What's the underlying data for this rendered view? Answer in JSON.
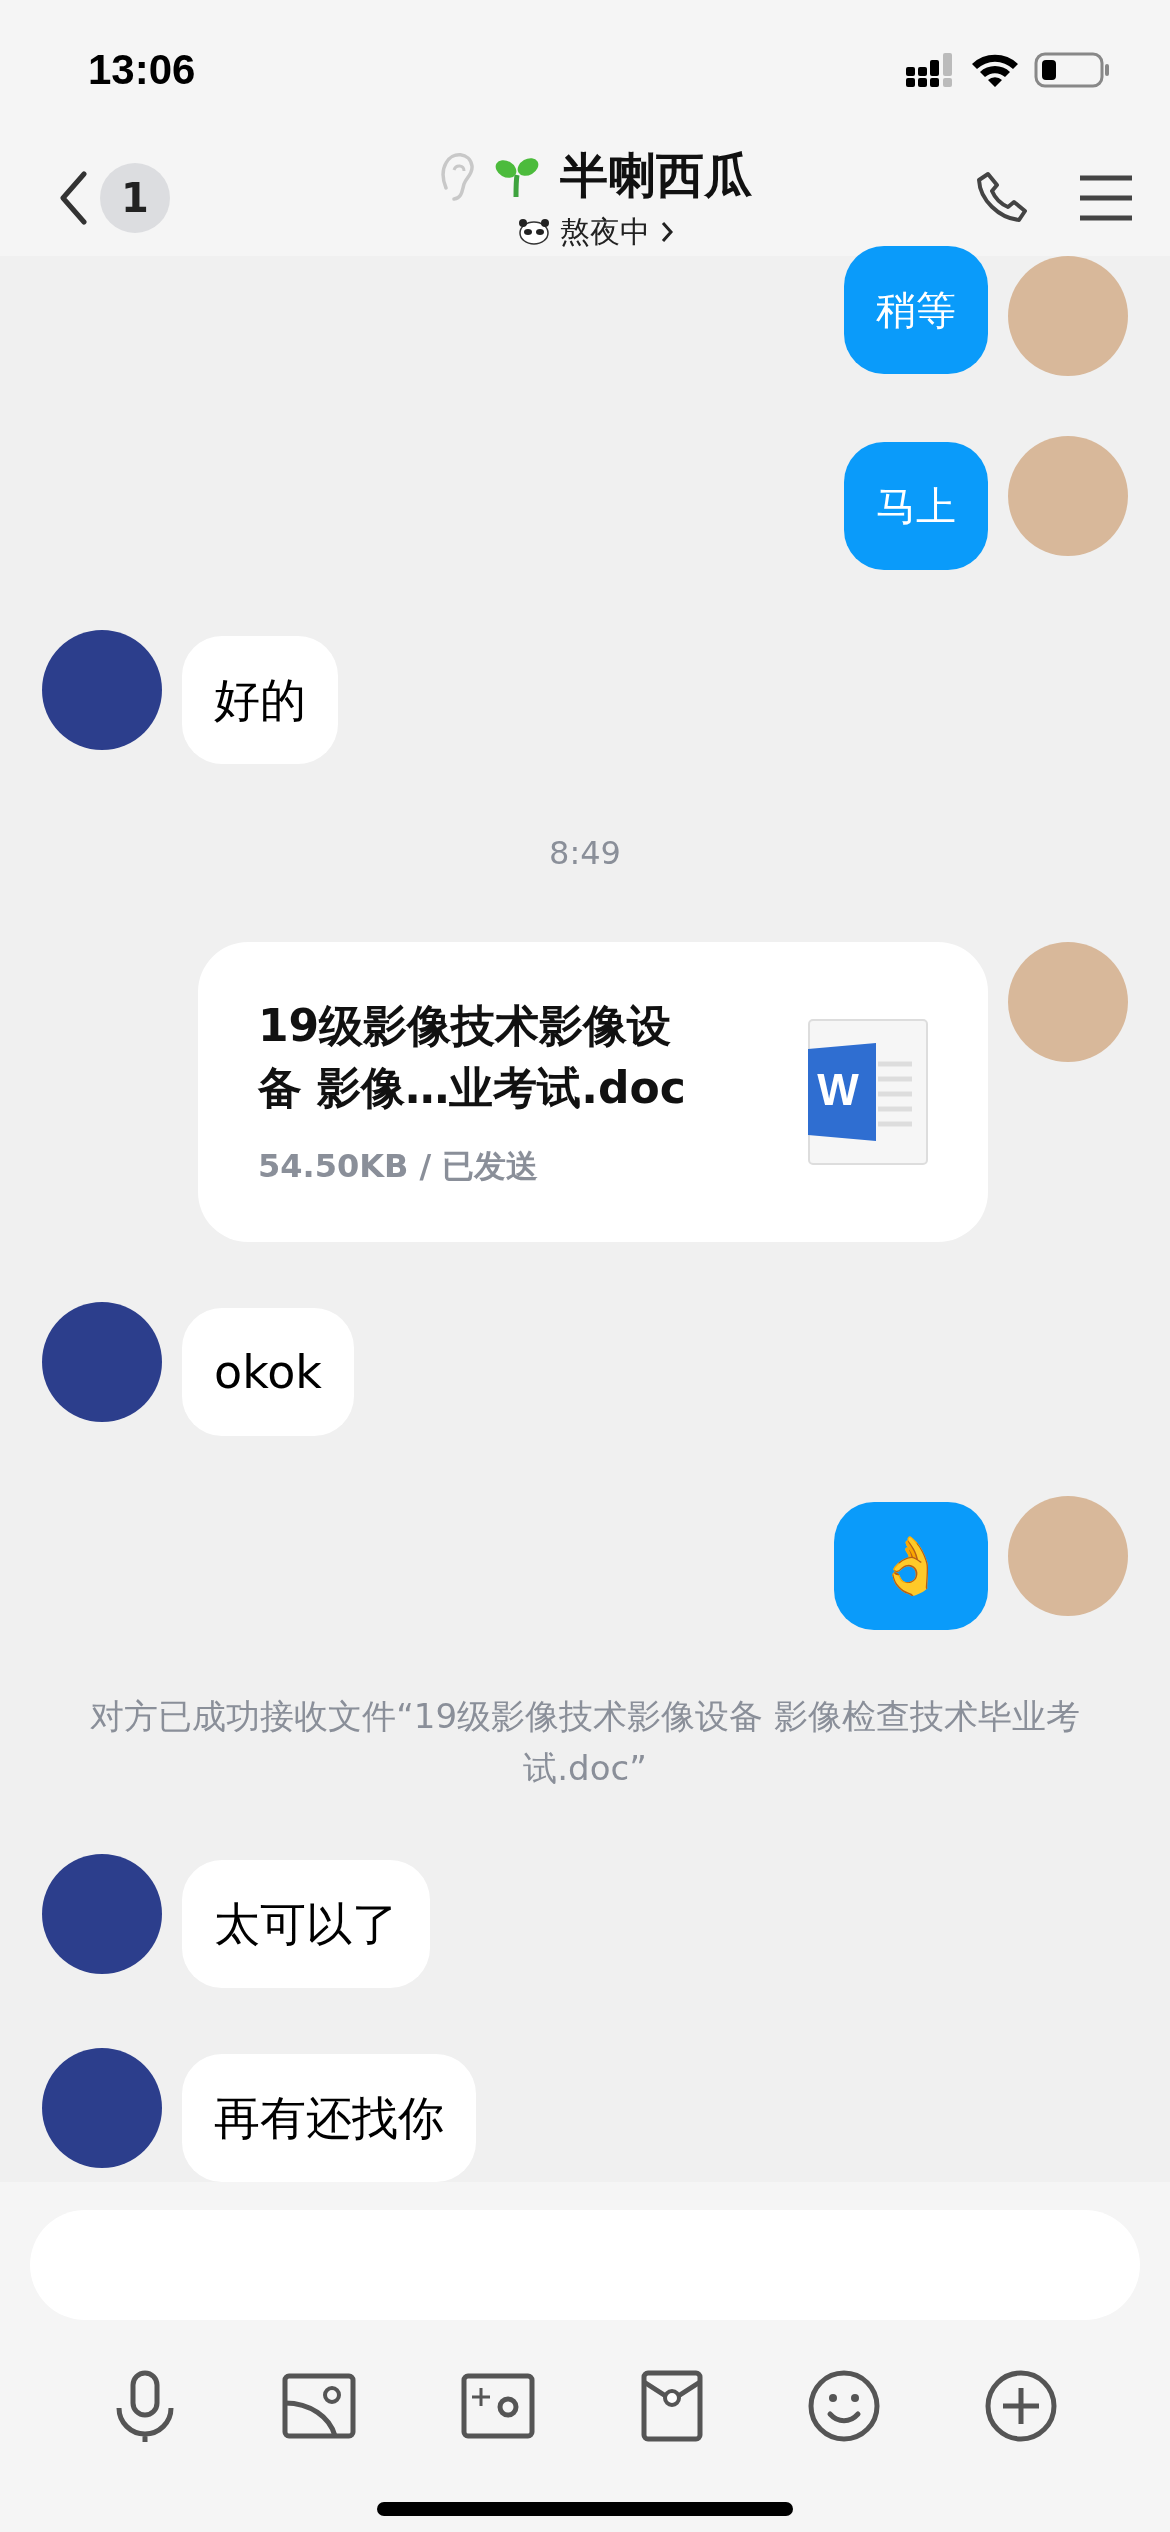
{
  "status_bar": {
    "time": "13:06"
  },
  "header": {
    "back_badge": "1",
    "title": "半喇西瓜",
    "status": "熬夜中"
  },
  "messages": [
    {
      "kind": "text",
      "outgoing": true,
      "text": "稍等"
    },
    {
      "kind": "text",
      "outgoing": true,
      "text": "马上"
    },
    {
      "kind": "text",
      "outgoing": false,
      "text": "好的"
    },
    {
      "kind": "time",
      "text": "8:49"
    },
    {
      "kind": "file",
      "outgoing": true,
      "name": "19级影像技术影像设备 影像…业考试.doc",
      "meta": "54.50KB / 已发送",
      "icon_letter": "W"
    },
    {
      "kind": "text",
      "outgoing": false,
      "text": "okok"
    },
    {
      "kind": "emoji",
      "outgoing": true,
      "text": "👌"
    },
    {
      "kind": "system",
      "text": "对方已成功接收文件“19级影像技术影像设备 影像检查技术毕业考试.doc”"
    },
    {
      "kind": "text",
      "outgoing": false,
      "text": "太可以了"
    },
    {
      "kind": "text",
      "outgoing": false,
      "text": "再有还找你"
    }
  ]
}
